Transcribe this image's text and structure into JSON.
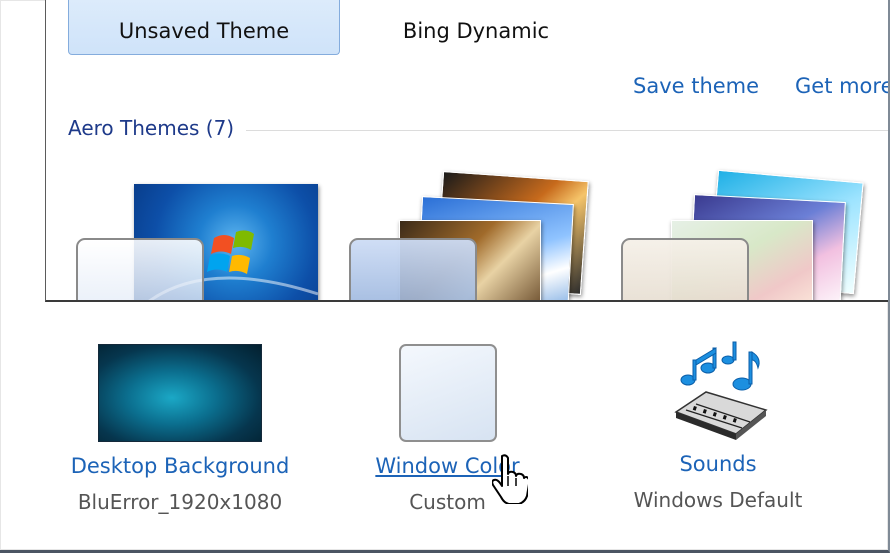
{
  "themes": {
    "tabs": [
      {
        "label": "Unsaved Theme",
        "selected": true
      },
      {
        "label": "Bing Dynamic",
        "selected": false
      }
    ],
    "actions": {
      "save_theme": "Save theme",
      "get_more": "Get more"
    },
    "group_title": "Aero Themes (7)"
  },
  "settings": {
    "desktop_background": {
      "label": "Desktop Background",
      "value": "BluError_1920x1080",
      "icon": "desktop-image"
    },
    "window_color": {
      "label": "Window Color",
      "value": "Custom",
      "icon": "color-swatch"
    },
    "sounds": {
      "label": "Sounds",
      "value": "Windows Default",
      "icon": "music-keyboard"
    }
  },
  "colors": {
    "link": "#1c63b7",
    "selected_bg": "#dcebfb",
    "selected_border": "#84acdd"
  }
}
